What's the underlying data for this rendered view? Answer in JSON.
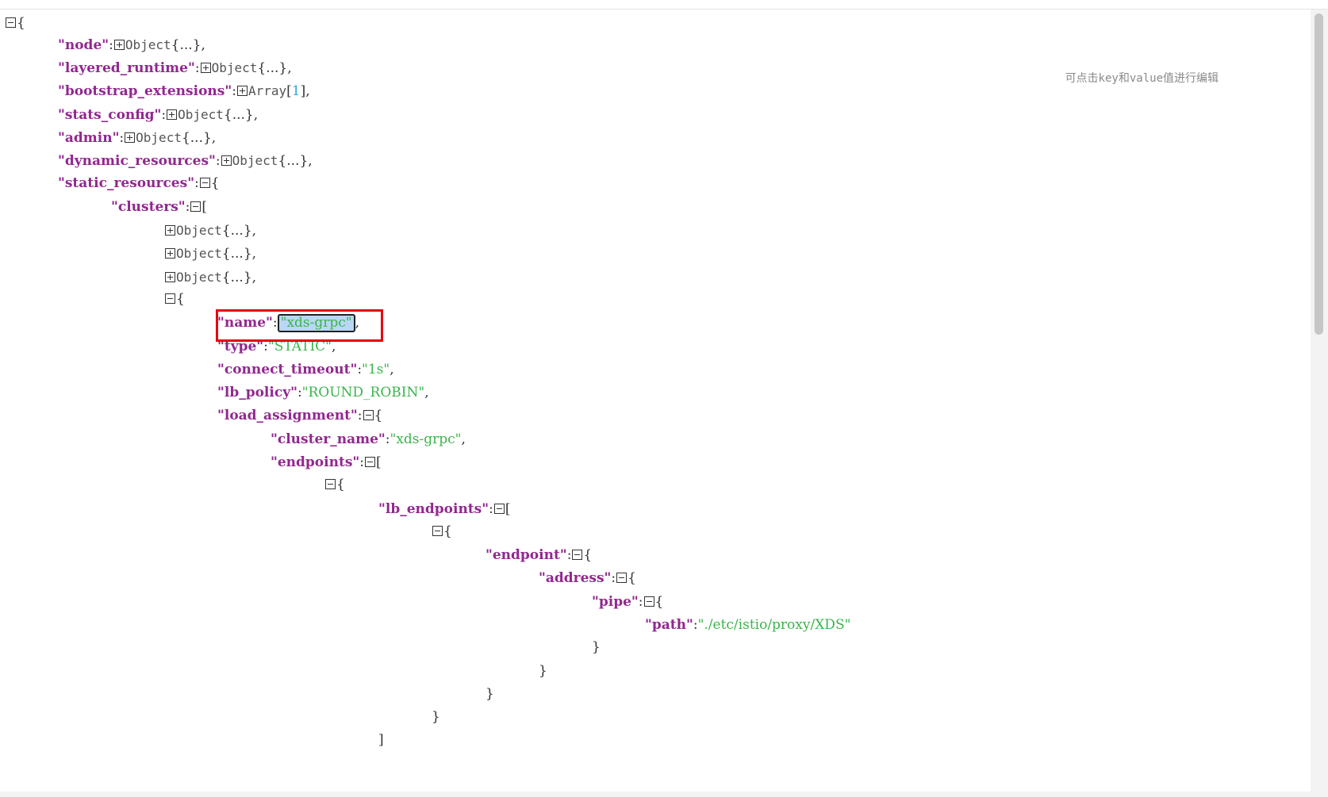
{
  "hint": "可点击key和value值进行编辑",
  "lines": [
    {
      "parts": [
        {
          "toggle": "minus"
        },
        {
          "t": "{",
          "c": "punct"
        }
      ]
    },
    {
      "parts": [
        {
          "t": "\"node\"",
          "c": "key"
        },
        {
          "t": ":",
          "c": "punct"
        },
        {
          "toggle": "plus"
        },
        {
          "t": "Object",
          "c": "type"
        },
        {
          "t": "{...},",
          "c": "punct"
        }
      ]
    },
    {
      "parts": [
        {
          "t": "\"layered_runtime\"",
          "c": "key"
        },
        {
          "t": ":",
          "c": "punct"
        },
        {
          "toggle": "plus"
        },
        {
          "t": "Object",
          "c": "type"
        },
        {
          "t": "{...},",
          "c": "punct"
        }
      ]
    },
    {
      "parts": [
        {
          "t": "\"bootstrap_extensions\"",
          "c": "key"
        },
        {
          "t": ":",
          "c": "punct"
        },
        {
          "toggle": "plus"
        },
        {
          "t": "Array",
          "c": "type"
        },
        {
          "t": "[",
          "c": "punct"
        },
        {
          "t": "1",
          "c": "num"
        },
        {
          "t": "],",
          "c": "punct"
        }
      ]
    },
    {
      "parts": [
        {
          "t": "\"stats_config\"",
          "c": "key"
        },
        {
          "t": ":",
          "c": "punct"
        },
        {
          "toggle": "plus"
        },
        {
          "t": "Object",
          "c": "type"
        },
        {
          "t": "{...},",
          "c": "punct"
        }
      ]
    },
    {
      "parts": [
        {
          "t": "\"admin\"",
          "c": "key"
        },
        {
          "t": ":",
          "c": "punct"
        },
        {
          "toggle": "plus"
        },
        {
          "t": "Object",
          "c": "type"
        },
        {
          "t": "{...},",
          "c": "punct"
        }
      ]
    },
    {
      "parts": [
        {
          "t": "\"dynamic_resources\"",
          "c": "key"
        },
        {
          "t": ":",
          "c": "punct"
        },
        {
          "toggle": "plus"
        },
        {
          "t": "Object",
          "c": "type"
        },
        {
          "t": "{...},",
          "c": "punct"
        }
      ]
    },
    {
      "parts": [
        {
          "t": "\"static_resources\"",
          "c": "key"
        },
        {
          "t": ":",
          "c": "punct"
        },
        {
          "toggle": "minus"
        },
        {
          "t": "{",
          "c": "punct"
        }
      ]
    },
    {
      "parts": [
        {
          "t": "\"clusters\"",
          "c": "key"
        },
        {
          "t": ":",
          "c": "punct"
        },
        {
          "toggle": "minus"
        },
        {
          "t": "[",
          "c": "punct"
        }
      ]
    },
    {
      "parts": [
        {
          "toggle": "plus"
        },
        {
          "t": "Object",
          "c": "type"
        },
        {
          "t": "{...},",
          "c": "punct"
        }
      ]
    },
    {
      "parts": [
        {
          "toggle": "plus"
        },
        {
          "t": "Object",
          "c": "type"
        },
        {
          "t": "{...},",
          "c": "punct"
        }
      ]
    },
    {
      "parts": [
        {
          "toggle": "plus"
        },
        {
          "t": "Object",
          "c": "type"
        },
        {
          "t": "{...},",
          "c": "punct"
        }
      ]
    },
    {
      "parts": [
        {
          "toggle": "minus"
        },
        {
          "t": "{",
          "c": "punct"
        }
      ]
    },
    {
      "parts": [
        {
          "t": "\"name\"",
          "c": "key"
        },
        {
          "t": ":",
          "c": "punct"
        },
        {
          "t": "\"xds-grpc\"",
          "c": "str",
          "selected": true
        },
        {
          "t": ",",
          "c": "punct"
        }
      ]
    },
    {
      "parts": [
        {
          "t": "\"type\"",
          "c": "key"
        },
        {
          "t": ":",
          "c": "punct"
        },
        {
          "t": "\"STATIC\"",
          "c": "str"
        },
        {
          "t": ",",
          "c": "punct"
        }
      ]
    },
    {
      "parts": [
        {
          "t": "\"connect_timeout\"",
          "c": "key"
        },
        {
          "t": ":",
          "c": "punct"
        },
        {
          "t": "\"1s\"",
          "c": "str"
        },
        {
          "t": ",",
          "c": "punct"
        }
      ]
    },
    {
      "parts": [
        {
          "t": "\"lb_policy\"",
          "c": "key"
        },
        {
          "t": ":",
          "c": "punct"
        },
        {
          "t": "\"ROUND_ROBIN\"",
          "c": "str"
        },
        {
          "t": ",",
          "c": "punct"
        }
      ]
    },
    {
      "parts": [
        {
          "t": "\"load_assignment\"",
          "c": "key"
        },
        {
          "t": ":",
          "c": "punct"
        },
        {
          "toggle": "minus"
        },
        {
          "t": "{",
          "c": "punct"
        }
      ]
    },
    {
      "parts": [
        {
          "t": "\"cluster_name\"",
          "c": "key"
        },
        {
          "t": ":",
          "c": "punct"
        },
        {
          "t": "\"xds-grpc\"",
          "c": "str"
        },
        {
          "t": ",",
          "c": "punct"
        }
      ]
    },
    {
      "parts": [
        {
          "t": "\"endpoints\"",
          "c": "key"
        },
        {
          "t": ":",
          "c": "punct"
        },
        {
          "toggle": "minus"
        },
        {
          "t": "[",
          "c": "punct"
        }
      ]
    },
    {
      "parts": [
        {
          "toggle": "minus"
        },
        {
          "t": "{",
          "c": "punct"
        }
      ]
    },
    {
      "parts": [
        {
          "t": "\"lb_endpoints\"",
          "c": "key"
        },
        {
          "t": ":",
          "c": "punct"
        },
        {
          "toggle": "minus"
        },
        {
          "t": "[",
          "c": "punct"
        }
      ]
    },
    {
      "parts": [
        {
          "toggle": "minus"
        },
        {
          "t": "{",
          "c": "punct"
        }
      ]
    },
    {
      "parts": [
        {
          "t": "\"endpoint\"",
          "c": "key"
        },
        {
          "t": ":",
          "c": "punct"
        },
        {
          "toggle": "minus"
        },
        {
          "t": "{",
          "c": "punct"
        }
      ]
    },
    {
      "parts": [
        {
          "t": "\"address\"",
          "c": "key"
        },
        {
          "t": ":",
          "c": "punct"
        },
        {
          "toggle": "minus"
        },
        {
          "t": "{",
          "c": "punct"
        }
      ]
    },
    {
      "parts": [
        {
          "t": "\"pipe\"",
          "c": "key"
        },
        {
          "t": ":",
          "c": "punct"
        },
        {
          "toggle": "minus"
        },
        {
          "t": "{",
          "c": "punct"
        }
      ]
    },
    {
      "parts": [
        {
          "t": "\"path\"",
          "c": "key"
        },
        {
          "t": ":",
          "c": "punct"
        },
        {
          "t": "\"./etc/istio/proxy/XDS\"",
          "c": "str"
        }
      ]
    },
    {
      "parts": [
        {
          "t": "}",
          "c": "punct"
        }
      ]
    },
    {
      "parts": [
        {
          "t": "}",
          "c": "punct"
        }
      ]
    },
    {
      "parts": [
        {
          "t": "}",
          "c": "punct"
        }
      ]
    },
    {
      "parts": [
        {
          "t": "}",
          "c": "punct"
        }
      ]
    },
    {
      "parts": [
        {
          "t": "]",
          "c": "punct"
        }
      ]
    }
  ]
}
